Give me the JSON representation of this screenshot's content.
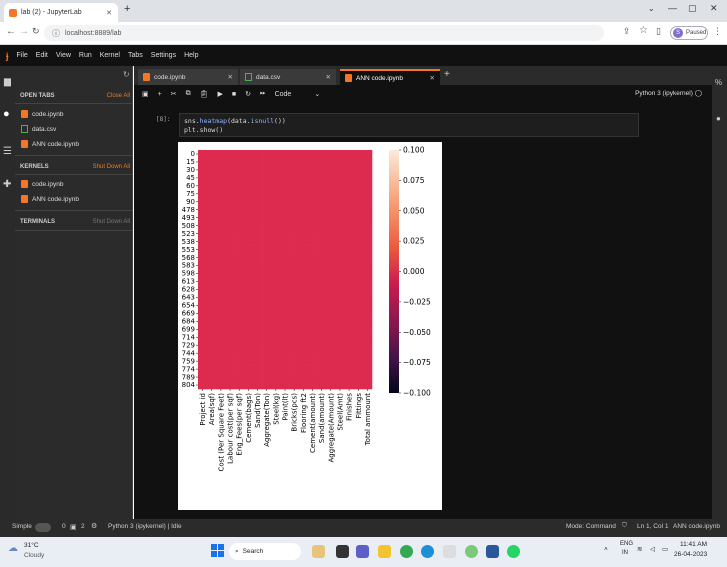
{
  "browser": {
    "tab_title": "lab (2) - JupyterLab",
    "url": "localhost:8889/lab",
    "profile_letter": "S",
    "profile_state": "Paused"
  },
  "jupyter": {
    "menu": [
      "File",
      "Edit",
      "View",
      "Run",
      "Kernel",
      "Tabs",
      "Settings",
      "Help"
    ],
    "sidebar": {
      "open_tabs_header": "OPEN TABS",
      "close_all": "Close All",
      "open_tabs": [
        {
          "name": "code.ipynb",
          "type": "notebook"
        },
        {
          "name": "data.csv",
          "type": "csv"
        },
        {
          "name": "ANN code.ipynb",
          "type": "notebook"
        }
      ],
      "kernels_header": "KERNELS",
      "shut_down_all": "Shut Down All",
      "kernels": [
        {
          "name": "code.ipynb"
        },
        {
          "name": "ANN code.ipynb"
        }
      ],
      "terminals_header": "TERMINALS",
      "terminals_shut_down": "Shut Down All"
    },
    "doc_tabs": [
      {
        "label": "code.ipynb",
        "type": "notebook",
        "active": false
      },
      {
        "label": "data.csv",
        "type": "csv",
        "active": false
      },
      {
        "label": "ANN code.ipynb",
        "type": "notebook",
        "active": true
      }
    ],
    "toolbar": {
      "cell_type": "Code",
      "kernel": "Python 3 (ipykernel)"
    },
    "cell": {
      "prompt": "[8]:",
      "line1_a": "sns.",
      "line1_b": "heatmap",
      "line1_c": "(data.",
      "line1_d": "isnull",
      "line1_e": "())",
      "line2": "plt.show()"
    },
    "status": {
      "mode": "Simple",
      "count_a": "0",
      "count_b": "2",
      "kernel_status": "Python 3 (ipykernel) | Idle",
      "command_mode": "Mode: Command",
      "cursor": "Ln 1, Col 1",
      "file": "ANN code.ipynb"
    }
  },
  "taskbar": {
    "temp": "31°C",
    "weather": "Cloudy",
    "search": "Search",
    "lang": "ENG",
    "lang2": "IN",
    "time": "11:41 AM",
    "date": "26-04-2023"
  },
  "chart_data": {
    "type": "heatmap",
    "rows": [
      "0",
      "15",
      "30",
      "45",
      "60",
      "75",
      "90",
      "478",
      "493",
      "508",
      "523",
      "538",
      "553",
      "568",
      "583",
      "598",
      "613",
      "628",
      "643",
      "654",
      "669",
      "684",
      "699",
      "714",
      "729",
      "744",
      "759",
      "774",
      "789",
      "804"
    ],
    "columns": [
      "Project id",
      "Area(sqf)",
      "Cost (Per Square Feet)",
      "Labour cost(per sqf)",
      "Eng_Fees(per sqf)",
      "Cement(bags)",
      "Sand(Ton)",
      "Aggregate(Ton)",
      "Steel(kg)",
      "Paint(lt)",
      "Bricks(pcs)",
      "Flooring ft2",
      "Cement(amount)",
      "Sand(amount)",
      "Aggregate(Amount)",
      "Steel(Amt)",
      "Finishes",
      "Fittings",
      "Total ammount"
    ],
    "values_all": 0,
    "colorbar_ticks": [
      "0.100",
      "0.075",
      "0.050",
      "0.025",
      "0.000",
      "−0.025",
      "−0.050",
      "−0.075",
      "−0.100"
    ],
    "colorbar_range": [
      -0.1,
      0.1
    ],
    "cell_color": "#dc2b4e"
  }
}
